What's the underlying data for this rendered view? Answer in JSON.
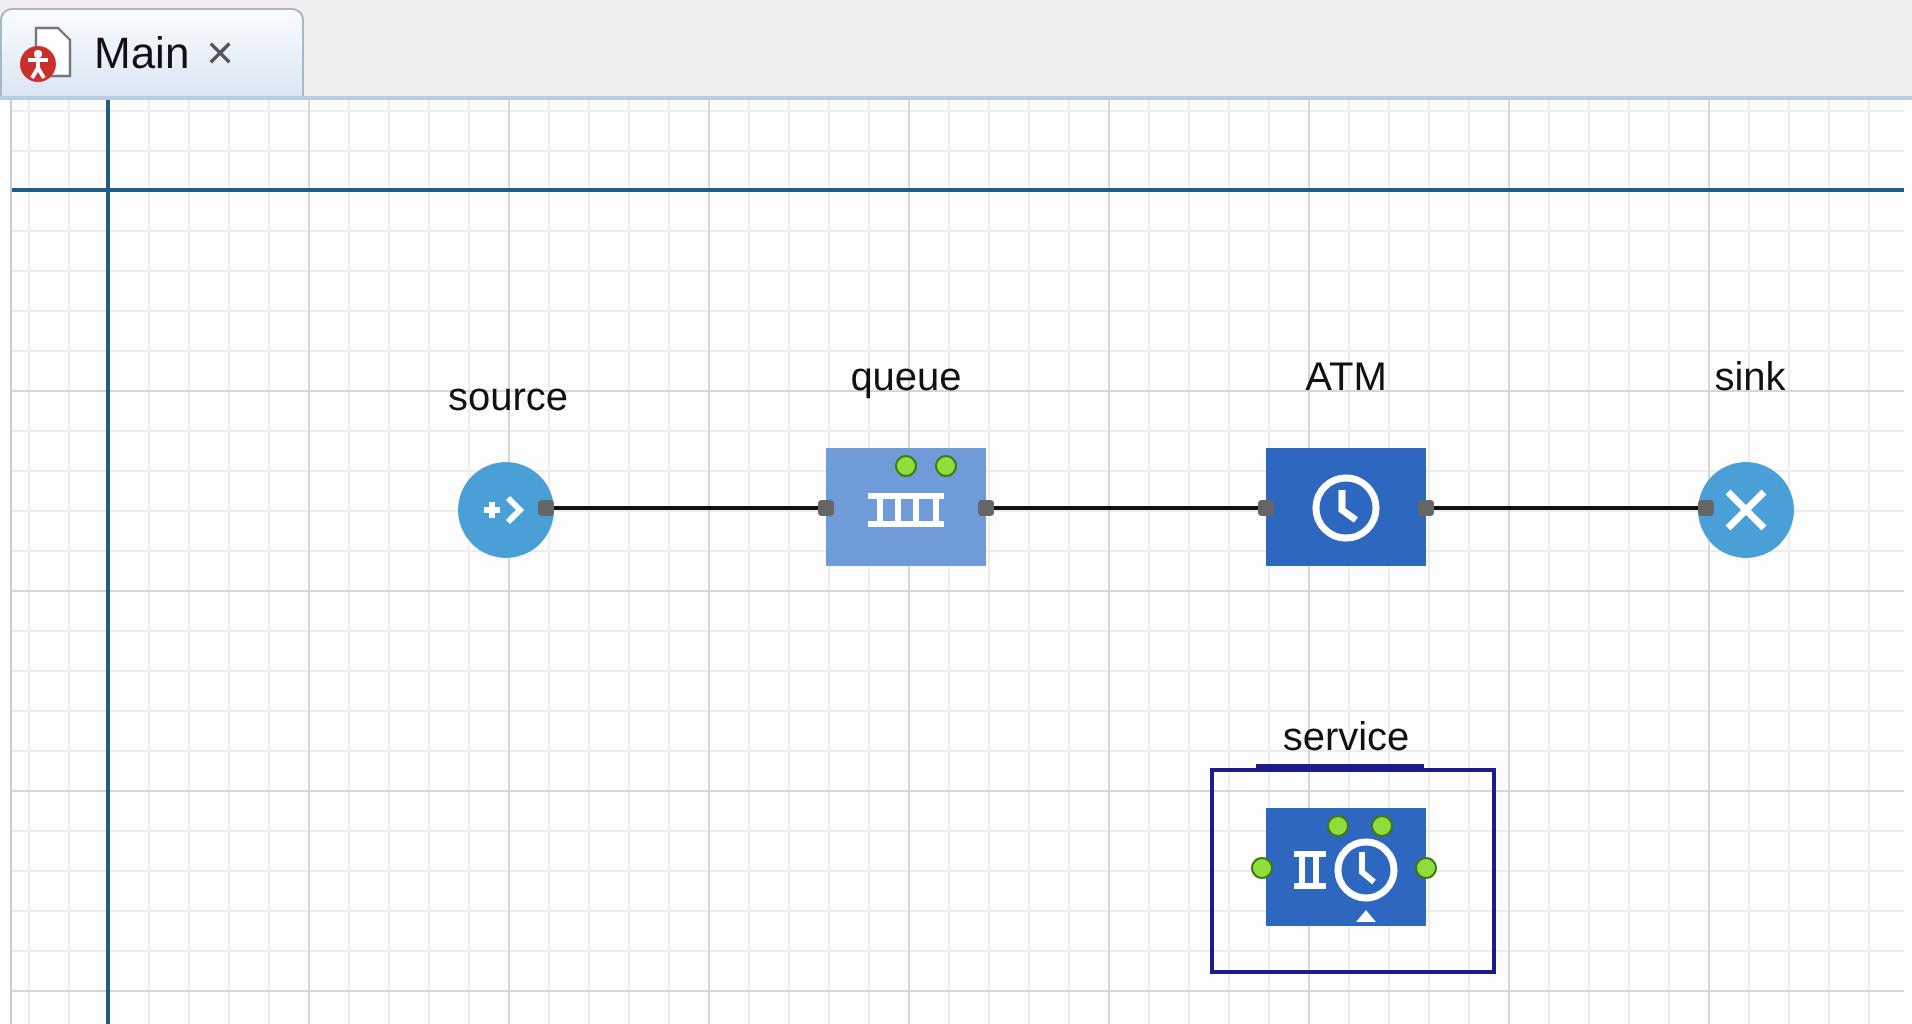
{
  "tabs": [
    {
      "label": "Main",
      "selected": true,
      "close": "✕"
    }
  ],
  "nodes": [
    {
      "kind": "source",
      "label": "source",
      "selected": false
    },
    {
      "kind": "queue",
      "label": "queue",
      "selected": false
    },
    {
      "kind": "delay",
      "label": "ATM",
      "selected": false
    },
    {
      "kind": "sink",
      "label": "sink",
      "selected": false
    },
    {
      "kind": "service",
      "label": "service",
      "selected": true
    }
  ]
}
